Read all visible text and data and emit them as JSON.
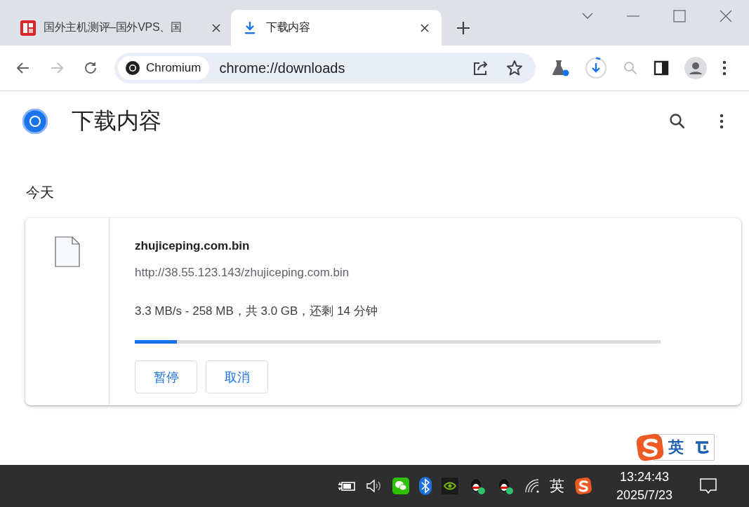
{
  "tabs": [
    {
      "kind": "site",
      "title": "国外主机测评–国外VPS、国",
      "selected": false
    },
    {
      "kind": "downloads",
      "title": "下载内容",
      "selected": true
    }
  ],
  "nav_buttons": [
    {
      "kind": "back",
      "disabled": false
    },
    {
      "kind": "forward",
      "disabled": true
    },
    {
      "kind": "reload",
      "disabled": false
    }
  ],
  "omnibox": {
    "chip": "Chromium",
    "url": "chrome://downloads"
  },
  "page": {
    "title": "下载内容",
    "section": "今天",
    "downloads": [
      {
        "file_name": "zhujiceping.com.bin",
        "url": "http://38.55.123.143/zhujiceping.com.bin",
        "status": "3.3 MB/s - 258 MB，共 3.0 GB，还剩 14 分钟",
        "level": 0.08,
        "buttons": [
          "暂停",
          "取消"
        ]
      }
    ]
  },
  "ime_bar": {
    "mode": "英"
  },
  "taskbar": {
    "ime": "英",
    "time": "13:24:43",
    "date": "2025/7/23"
  }
}
